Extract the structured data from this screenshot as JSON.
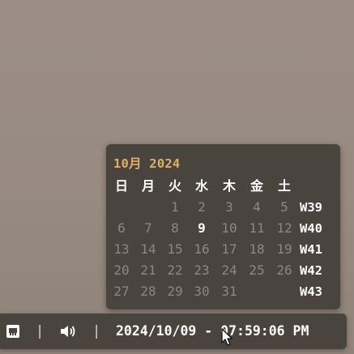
{
  "calendar": {
    "header": "10月 2024",
    "weekdays": [
      "日",
      "月",
      "火",
      "水",
      "木",
      "金",
      "土"
    ],
    "weeks": [
      {
        "label": "W39",
        "days": [
          "",
          "",
          "1",
          "2",
          "3",
          "4",
          "5"
        ]
      },
      {
        "label": "W40",
        "days": [
          "6",
          "7",
          "8",
          "9",
          "10",
          "11",
          "12"
        ]
      },
      {
        "label": "W41",
        "days": [
          "13",
          "14",
          "15",
          "16",
          "17",
          "18",
          "19"
        ]
      },
      {
        "label": "W42",
        "days": [
          "20",
          "21",
          "22",
          "23",
          "24",
          "25",
          "26"
        ]
      },
      {
        "label": "W43",
        "days": [
          "27",
          "28",
          "29",
          "30",
          "31",
          "",
          ""
        ]
      }
    ],
    "today": "9"
  },
  "panel": {
    "separator": "|",
    "clock": "2024/10/09 - 07:59:06 PM",
    "icons": [
      "network-icon",
      "volume-icon"
    ]
  },
  "colors": {
    "desktop": "#978a80",
    "popup_bg": "#4a443f",
    "header_accent": "#e0b060",
    "dim_day": "#8e8780",
    "today": "#ffffff"
  }
}
